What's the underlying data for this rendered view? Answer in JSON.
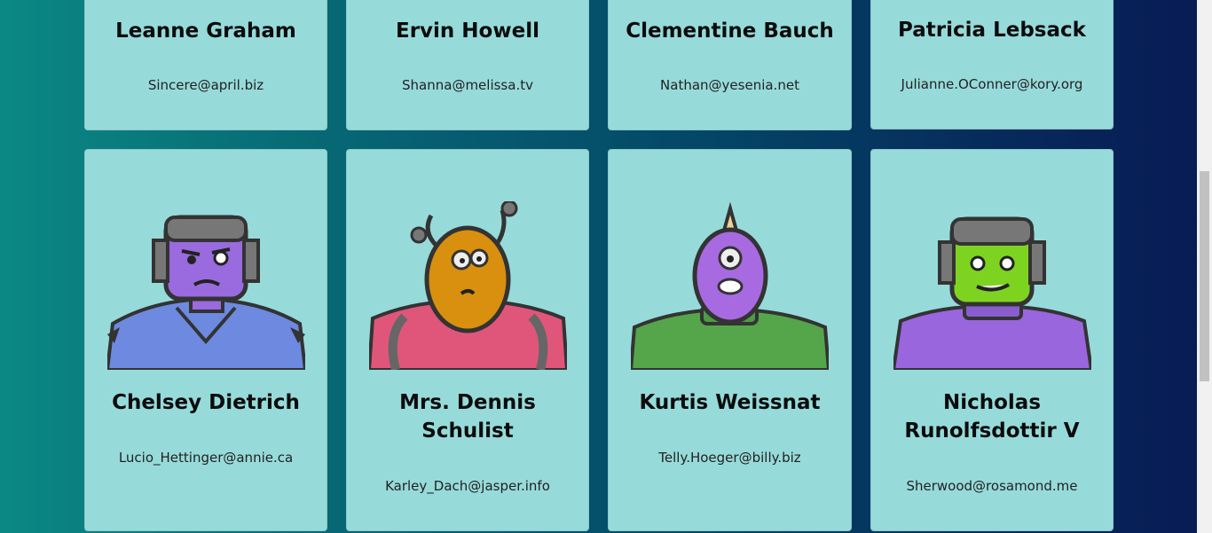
{
  "cards": [
    {
      "name": "Leanne Graham",
      "email": "Sincere@april.biz",
      "avatar": "robot-avatar"
    },
    {
      "name": "Ervin Howell",
      "email": "Shanna@melissa.tv",
      "avatar": "robot-avatar"
    },
    {
      "name": "Clementine Bauch",
      "email": "Nathan@yesenia.net",
      "avatar": "robot-avatar"
    },
    {
      "name": "Patricia Lebsack",
      "email": "Julianne.OConner@kory.org",
      "avatar": "robot-avatar"
    },
    {
      "name": "Chelsey Dietrich",
      "email": "Lucio_Hettinger@annie.ca",
      "avatar": "purple-robot-avatar"
    },
    {
      "name": "Mrs. Dennis Schulist",
      "email": "Karley_Dach@jasper.info",
      "avatar": "orange-alien-robot-avatar"
    },
    {
      "name": "Kurtis Weissnat",
      "email": "Telly.Hoeger@billy.biz",
      "avatar": "purple-cyclops-avatar"
    },
    {
      "name": "Nicholas Runolfsdottir V",
      "email": "Sherwood@rosamond.me",
      "avatar": "green-robot-avatar"
    }
  ],
  "colors": {
    "card_bg": "#97dada",
    "page_gradient": [
      "#0b8884",
      "#081a54"
    ]
  }
}
